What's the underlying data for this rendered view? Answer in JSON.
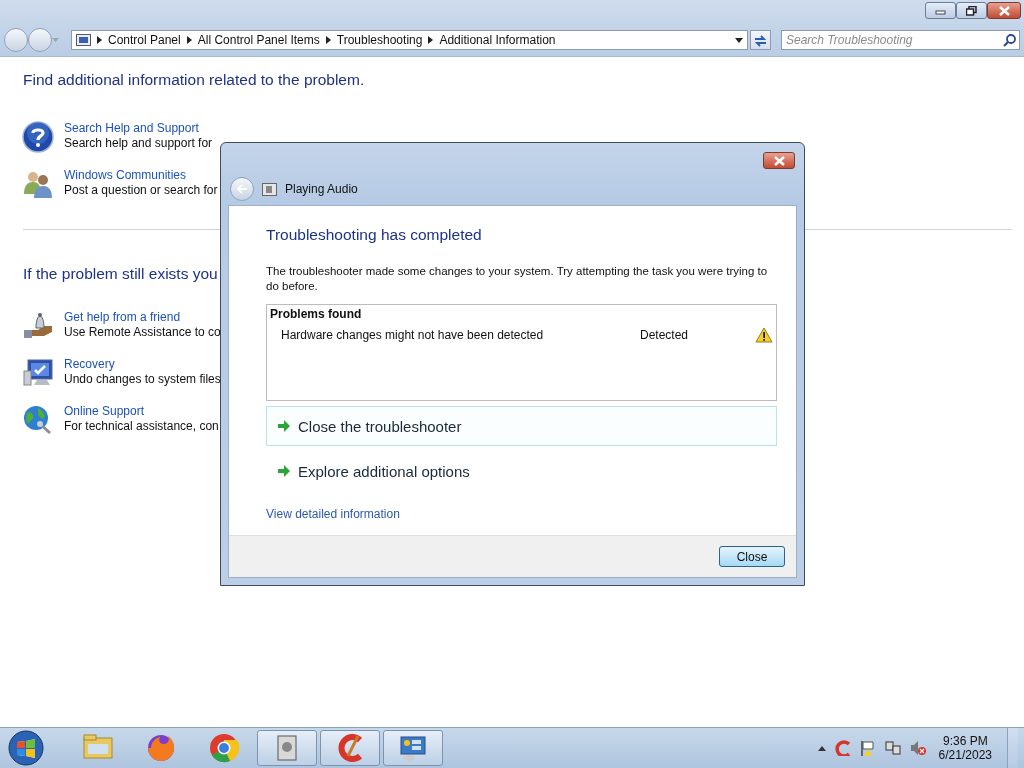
{
  "window": {
    "breadcrumb": [
      "Control Panel",
      "All Control Panel Items",
      "Troubleshooting",
      "Additional Information"
    ],
    "search": {
      "placeholder": "Search Troubleshooting"
    }
  },
  "content": {
    "heading": "Find additional information related to the problem.",
    "links": [
      {
        "kind": "help",
        "title": "Search Help and Support",
        "description": "Search help and support for"
      },
      {
        "kind": "people",
        "title": "Windows Communities",
        "description": "Post a question or search for"
      }
    ],
    "heading2": "If the problem still exists you",
    "links2": [
      {
        "kind": "remote",
        "title": "Get help from a friend",
        "description": "Use Remote Assistance to co"
      },
      {
        "kind": "recovery",
        "title": "Recovery",
        "description": "Undo changes to system files"
      },
      {
        "kind": "globe",
        "title": "Online Support",
        "description": "For technical assistance, con"
      }
    ]
  },
  "dialog": {
    "title": "Playing Audio",
    "heading": "Troubleshooting has completed",
    "message": "The troubleshooter made some changes to your system. Try attempting the task you were trying to do before.",
    "problems": {
      "header": "Problems found",
      "rows": [
        {
          "problem": "Hardware changes might not have been detected",
          "status": "Detected",
          "kind": "warning"
        }
      ]
    },
    "options": [
      {
        "label": "Close the troubleshooter",
        "selected": true
      },
      {
        "label": "Explore additional options",
        "selected": false
      }
    ],
    "details_link": "View detailed information",
    "button": "Close"
  },
  "taskbar": {
    "apps": [
      {
        "kind": "folder",
        "running": false
      },
      {
        "kind": "firefox",
        "running": false
      },
      {
        "kind": "chrome",
        "running": false
      },
      {
        "kind": "drive",
        "running": true
      },
      {
        "kind": "cleaner",
        "running": true
      },
      {
        "kind": "panel",
        "running": true
      }
    ],
    "clock": {
      "time": "9:36 PM",
      "date": "6/21/2023"
    }
  }
}
